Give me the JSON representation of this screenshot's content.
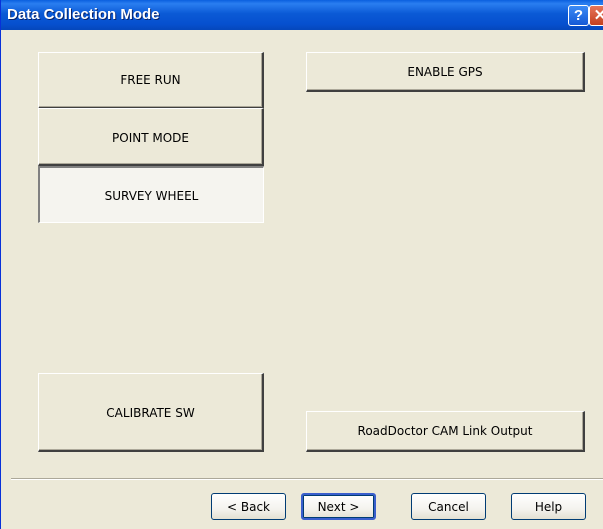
{
  "window": {
    "title": "Data Collection Mode",
    "help_glyph": "?",
    "close_glyph": "✕"
  },
  "mode_buttons": {
    "free_run": "FREE RUN",
    "point_mode": "POINT MODE",
    "survey_wheel": "SURVEY WHEEL",
    "selected": "SURVEY WHEEL"
  },
  "calibrate": {
    "label": "CALIBRATE SW"
  },
  "gps": {
    "label": "ENABLE GPS"
  },
  "roaddoctor": {
    "label": "RoadDoctor CAM Link Output"
  },
  "wizard_buttons": {
    "back": "< Back",
    "next": "Next >",
    "cancel": "Cancel",
    "help": "Help"
  },
  "colors": {
    "titlebar": "#0b5ad6",
    "face": "#ece9d8",
    "close": "#c4401f"
  }
}
